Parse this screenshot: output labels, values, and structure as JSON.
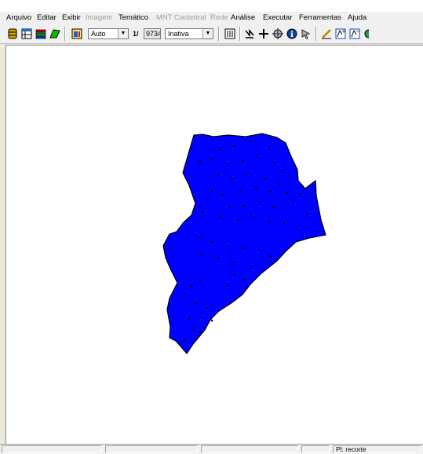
{
  "menu": {
    "items": [
      {
        "label": "Arquivo",
        "enabled": true
      },
      {
        "label": "Editar",
        "enabled": true
      },
      {
        "label": "Exibir",
        "enabled": true
      },
      {
        "label": "Imagem",
        "enabled": false
      },
      {
        "label": "Temático",
        "enabled": true
      },
      {
        "label": "MNT",
        "enabled": false
      },
      {
        "label": "Cadastral",
        "enabled": false
      },
      {
        "label": "Rede",
        "enabled": false
      },
      {
        "label": "Análise",
        "enabled": true
      },
      {
        "label": "Executar",
        "enabled": true
      },
      {
        "label": "Ferramentas",
        "enabled": true
      },
      {
        "label": "Ajuda",
        "enabled": true
      }
    ]
  },
  "toolbar": {
    "scale_mode": "Auto",
    "scale_prefix": "1/",
    "scale_value": "9734",
    "display_mode": "Inativa",
    "icons": [
      "database-icon",
      "table-icon",
      "layers-icon",
      "polygon-edit-icon",
      "window-icon",
      "draw-icon",
      "select-icon",
      "cursor-icon",
      "zoom-cross-icon",
      "pan-icon",
      "info-icon",
      "pointer-icon",
      "pencil-icon",
      "zoom-in-icon",
      "zoom-out-icon"
    ]
  },
  "map": {
    "fill_color": "#0000ff",
    "stroke_color": "#000000",
    "point_color": "#000000"
  },
  "status": {
    "plane_label": "Pl: recorte"
  }
}
